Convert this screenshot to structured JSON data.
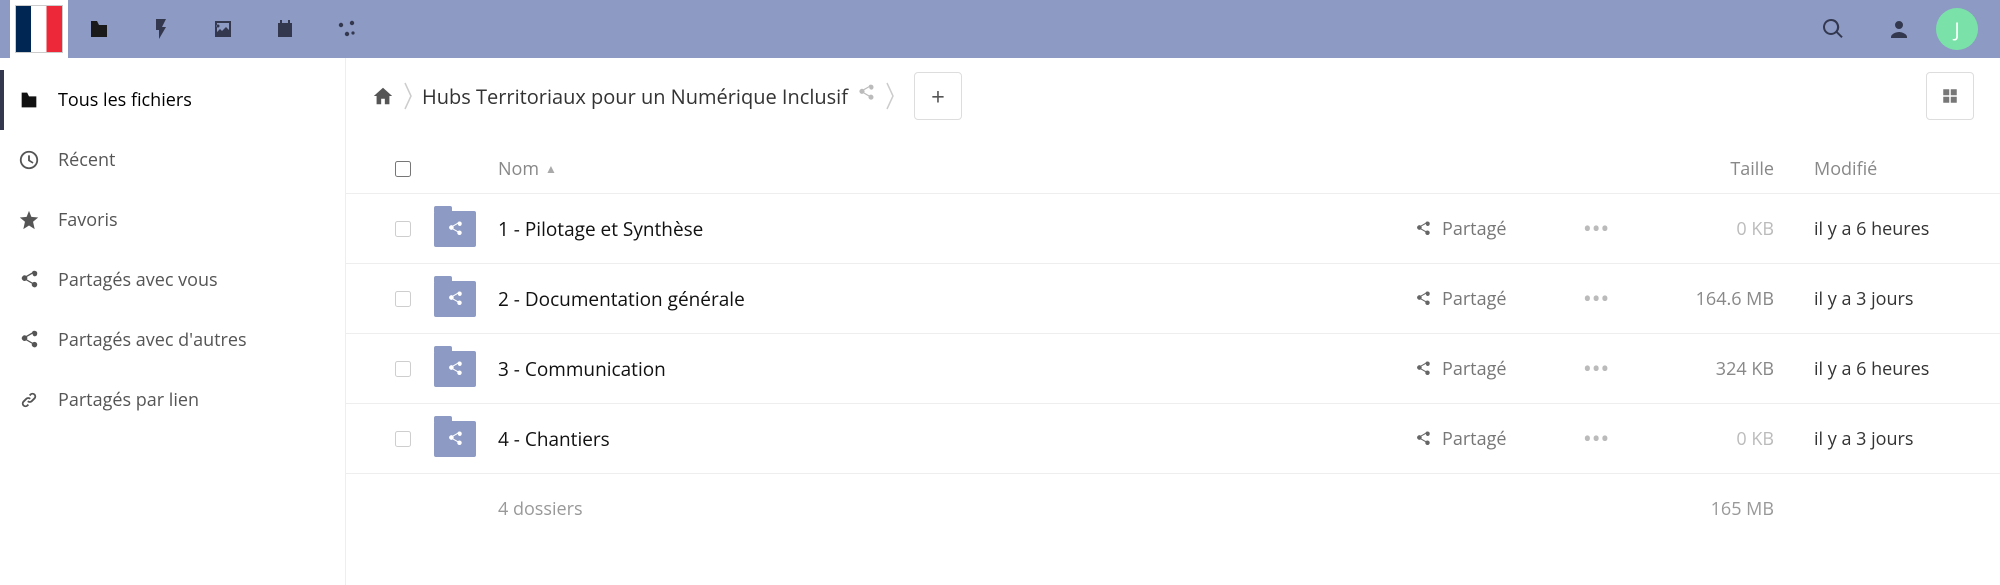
{
  "avatar_initial": "J",
  "sidebar": {
    "items": [
      {
        "label": "Tous les fichiers",
        "active": true
      },
      {
        "label": "Récent"
      },
      {
        "label": "Favoris"
      },
      {
        "label": "Partagés avec vous"
      },
      {
        "label": "Partagés avec d'autres"
      },
      {
        "label": "Partagés par lien"
      }
    ]
  },
  "breadcrumb": {
    "folder": "Hubs Territoriaux pour un Numérique Inclusif"
  },
  "columns": {
    "name": "Nom",
    "size": "Taille",
    "modified": "Modifié"
  },
  "shared_label": "Partagé",
  "rows": [
    {
      "name": "1 - Pilotage et Synthèse",
      "size": "0 KB",
      "dim": true,
      "modified": "il y a 6 heures"
    },
    {
      "name": "2 - Documentation générale",
      "size": "164.6 MB",
      "dim": false,
      "modified": "il y a 3 jours"
    },
    {
      "name": "3 - Communication",
      "size": "324 KB",
      "dim": false,
      "modified": "il y a 6 heures"
    },
    {
      "name": "4 - Chantiers",
      "size": "0 KB",
      "dim": true,
      "modified": "il y a 3 jours"
    }
  ],
  "summary": {
    "folders": "4 dossiers",
    "total_size": "165 MB"
  }
}
